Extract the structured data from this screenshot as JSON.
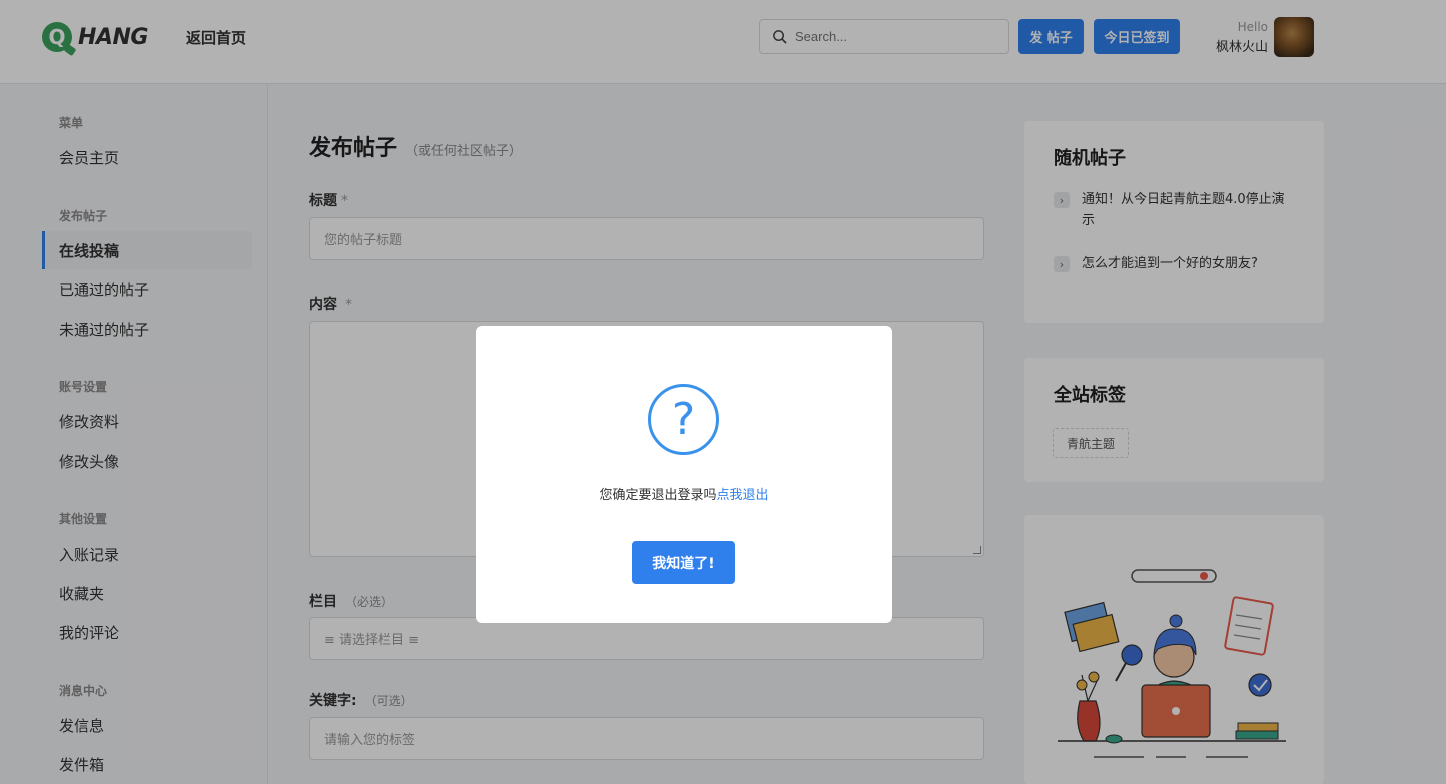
{
  "header": {
    "logo_letter": "Q",
    "logo_text": "HANG",
    "home_link": "返回首页",
    "search_placeholder": "Search...",
    "post_button": "发 帖子",
    "signin_button": "今日已签到",
    "hello": "Hello",
    "username": "枫林火山"
  },
  "sidebar": {
    "groups": [
      {
        "title": "菜单",
        "items": [
          "会员主页"
        ]
      },
      {
        "title": "发布帖子",
        "items": [
          "在线投稿",
          "已通过的帖子",
          "未通过的帖子"
        ]
      },
      {
        "title": "账号设置",
        "items": [
          "修改资料",
          "修改头像"
        ]
      },
      {
        "title": "其他设置",
        "items": [
          "入账记录",
          "收藏夹",
          "我的评论"
        ]
      },
      {
        "title": "消息中心",
        "items": [
          "发信息",
          "发件箱"
        ]
      }
    ],
    "active_item": "在线投稿"
  },
  "form": {
    "title": "发布帖子",
    "subtitle": "（或任何社区帖子）",
    "title_label": "标题",
    "title_star": "*",
    "title_placeholder": "您的帖子标题",
    "content_label": "内容",
    "content_star": "*",
    "column_label": "栏目",
    "column_note": "（必选）",
    "column_select": "≡ 请选择栏目 ≡",
    "keywords_label": "关键字:",
    "keywords_note": "（可选）",
    "keywords_placeholder": "请输入您的标签"
  },
  "right": {
    "random_title": "随机帖子",
    "random_posts": [
      "通知！从今日起青航主题4.0停止演示",
      "怎么才能追到一个好的女朋友?"
    ],
    "tags_title": "全站标签",
    "tags": [
      "青航主题"
    ]
  },
  "modal": {
    "icon": "?",
    "message": "您确定要退出登录吗",
    "link": "点我退出",
    "button": "我知道了!"
  },
  "colors": {
    "accent": "#2f80ed",
    "logo_green": "#3da35d",
    "overlay": "rgba(0,0,0,0.3)"
  }
}
